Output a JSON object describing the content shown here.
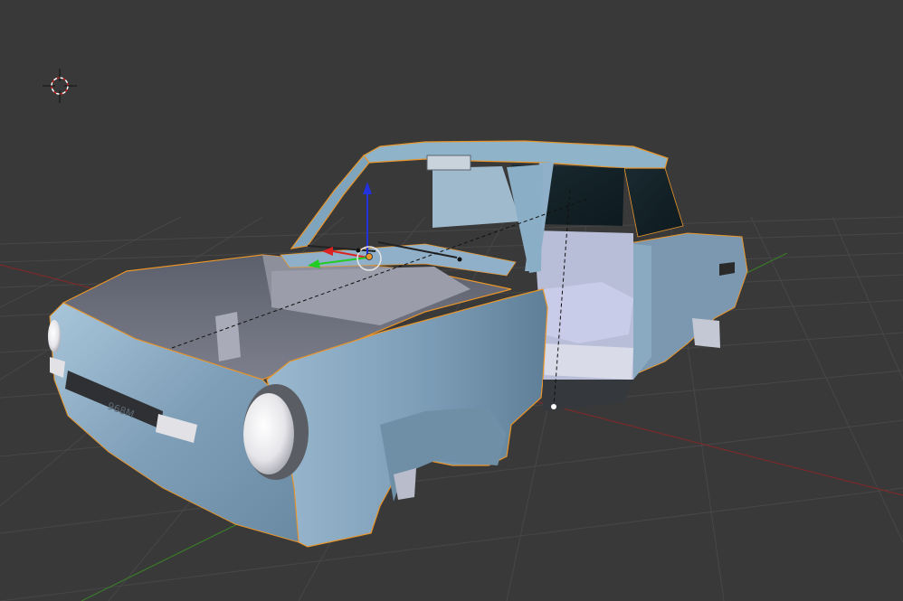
{
  "viewport": {
    "background_color": "#393939",
    "grid_color": "#4a4a4a",
    "x_axis_color": "#8a2b2b",
    "y_axis_color": "#3f8a2b"
  },
  "cursor_3d": {
    "icon": "crosshair-circle-icon",
    "color_ring_a": "#ffffff",
    "color_ring_b": "#cc2222"
  },
  "gizmo": {
    "x_color": "#dd2222",
    "y_color": "#22cc22",
    "z_color": "#2233dd"
  },
  "model": {
    "body_color": "#8fb0c8",
    "outline_color": "#e8952a",
    "badge_text": "968M"
  }
}
